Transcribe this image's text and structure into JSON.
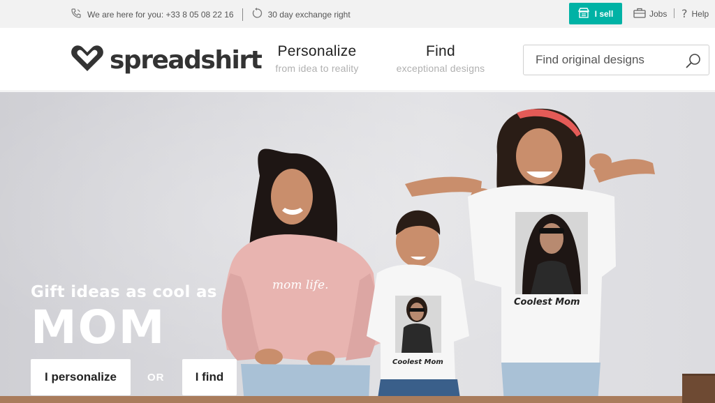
{
  "topbar": {
    "contact_text": "We are here for you: +33 8 05 08 22 16",
    "exchange_text": "30 day exchange right",
    "sell_label": "I sell",
    "jobs_label": "Jobs",
    "help_label": "Help",
    "accent_color": "#00b2a5"
  },
  "header": {
    "logo_text": "spreadshirt",
    "nav": [
      {
        "label": "Personalize",
        "sublabel": "from idea to reality"
      },
      {
        "label": "Find",
        "sublabel": "exceptional designs"
      }
    ],
    "search": {
      "placeholder": "Find original designs",
      "icon": "search-icon"
    }
  },
  "hero": {
    "headline_small": "Gift ideas as cool as",
    "headline_big": "MOM",
    "cta_personalize": "I personalize",
    "or_text": "OR",
    "cta_find": "I find",
    "shirt_print_text": "Coolest Mom",
    "hoodie_text": "mom life."
  }
}
